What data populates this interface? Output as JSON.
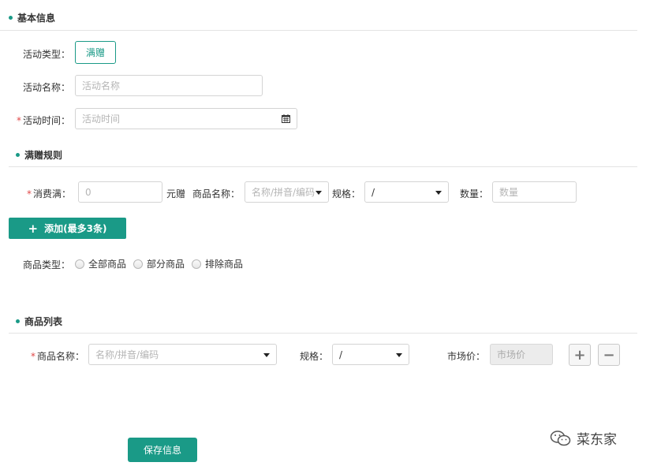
{
  "sections": {
    "basic_info": "基本信息",
    "rules": "满赠规则",
    "product_list": "商品列表"
  },
  "basic": {
    "type_label": "活动类型：",
    "type_value": "满赠",
    "name_label": "活动名称：",
    "name_placeholder": "活动名称",
    "time_label": "活动时间：",
    "time_placeholder": "活动时间"
  },
  "rules": {
    "spend_label": "消费满：",
    "spend_value": "0",
    "unit": "元赠",
    "product_name_label": "商品名称：",
    "product_name_placeholder": "名称/拼音/编码",
    "spec_label": "规格：",
    "spec_value": "/",
    "qty_label": "数量：",
    "qty_placeholder": "数量",
    "add_button": "添加(最多3条)",
    "product_type_label": "商品类型：",
    "product_type_options": [
      "全部商品",
      "部分商品",
      "排除商品"
    ]
  },
  "product_list": {
    "name_label": "商品名称：",
    "name_placeholder": "名称/拼音/编码",
    "spec_label": "规格：",
    "spec_value": "/",
    "price_label": "市场价：",
    "price_placeholder": "市场价",
    "add_icon": "plus-icon",
    "remove_icon": "minus-icon"
  },
  "save_button": "保存信息",
  "watermark": "菜东家",
  "colors": {
    "accent": "#1a9a87",
    "required": "#e04848"
  }
}
